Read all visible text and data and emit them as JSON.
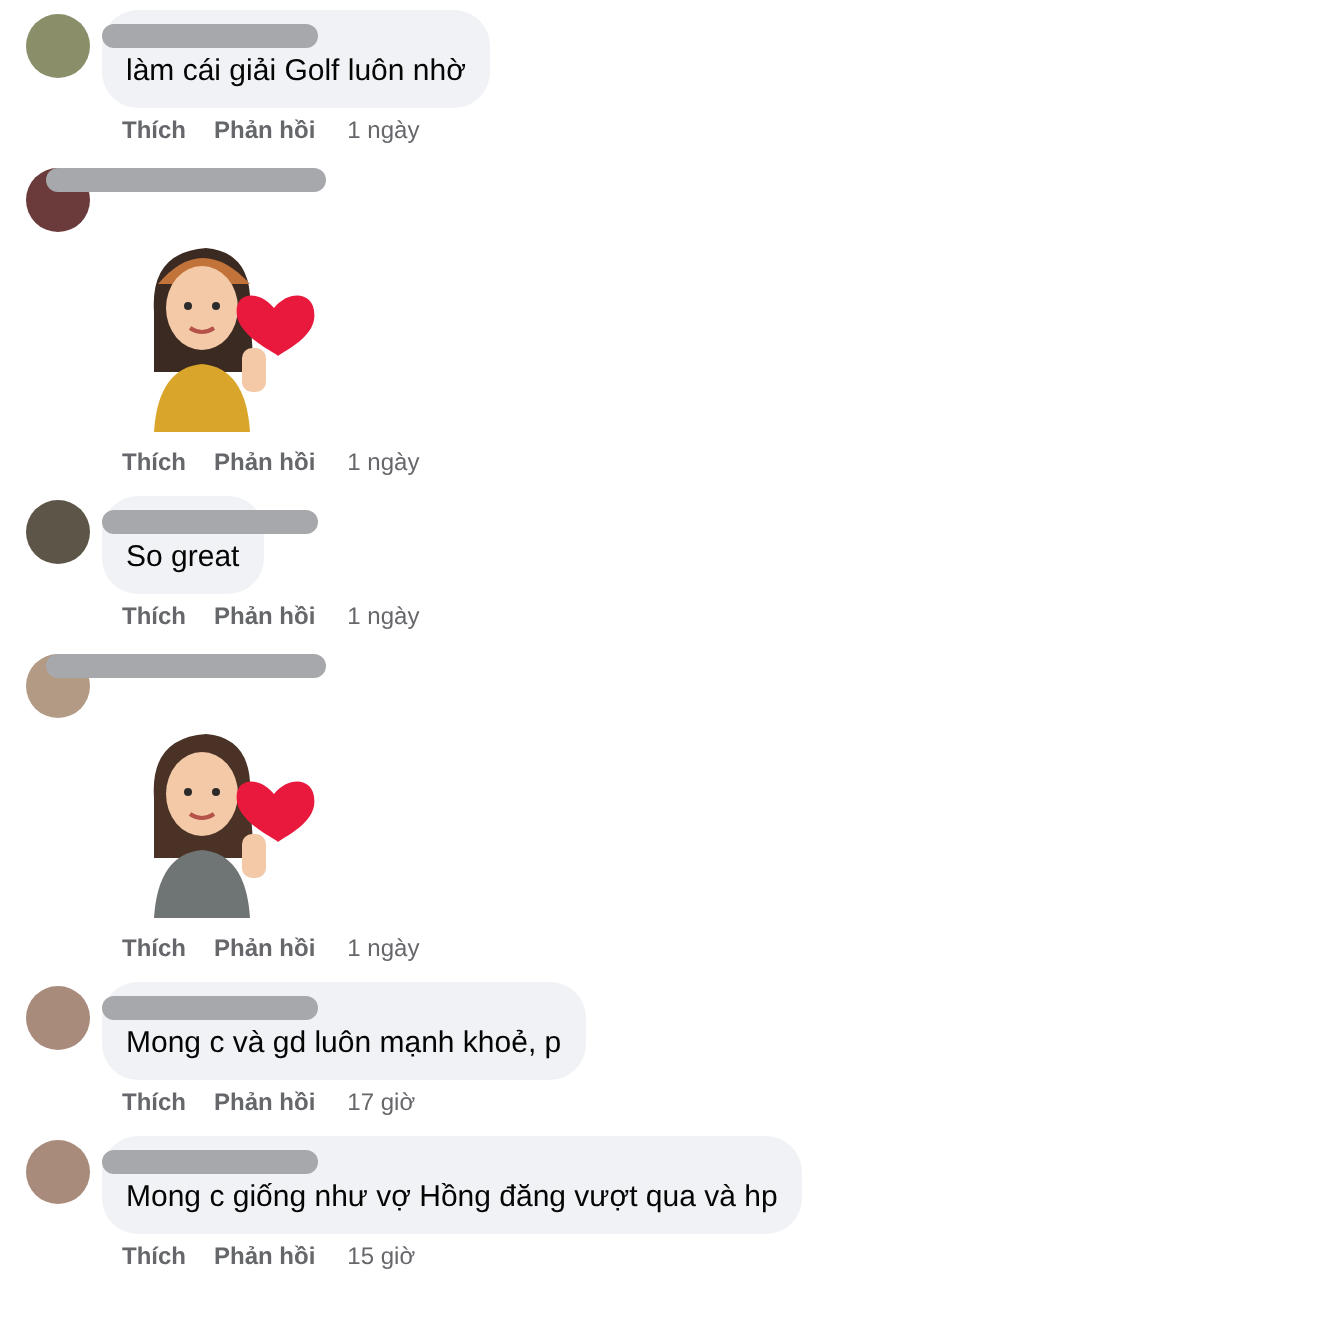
{
  "comments": [
    {
      "kind": "text",
      "text": "làm cái giải Golf luôn nhờ",
      "like": "Thích",
      "reply": "Phản hồi",
      "time": "1 ngày"
    },
    {
      "kind": "sticker",
      "like": "Thích",
      "reply": "Phản hồi",
      "time": "1 ngày"
    },
    {
      "kind": "text",
      "text": "So great",
      "like": "Thích",
      "reply": "Phản hồi",
      "time": "1 ngày"
    },
    {
      "kind": "sticker",
      "like": "Thích",
      "reply": "Phản hồi",
      "time": "1 ngày"
    },
    {
      "kind": "text",
      "text": "Mong c và gd luôn mạnh khoẻ, p",
      "like": "Thích",
      "reply": "Phản hồi",
      "time": "17 giờ"
    },
    {
      "kind": "text",
      "text": "Mong c giống như vợ Hồng đăng vượt qua và hp",
      "like": "Thích",
      "reply": "Phản hồi",
      "time": "15 giờ"
    }
  ]
}
